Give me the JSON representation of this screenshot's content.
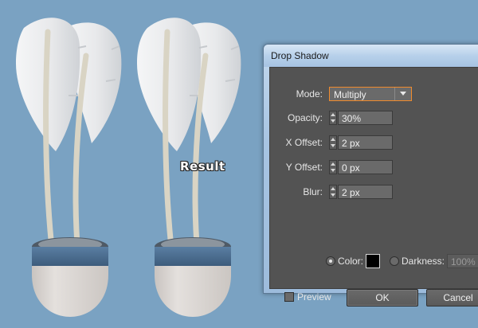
{
  "artwork": {
    "result_label": "Result",
    "colors": {
      "background": "#7aa2c2",
      "feather": "#e6e7e9",
      "pot_band": "#4e6f91",
      "pot_body": "#d8d3cf"
    }
  },
  "dialog": {
    "title": "Drop Shadow",
    "mode": {
      "label": "Mode:",
      "value": "Multiply"
    },
    "opacity": {
      "label": "Opacity:",
      "value": "30%"
    },
    "x_offset": {
      "label": "X Offset:",
      "value": "2 px"
    },
    "y_offset": {
      "label": "Y Offset:",
      "value": "0 px"
    },
    "blur": {
      "label": "Blur:",
      "value": "2 px"
    },
    "color_option": {
      "label": "Color:",
      "selected": true,
      "swatch": "#000000"
    },
    "darkness_option": {
      "label": "Darkness:",
      "value": "100%",
      "selected": false
    },
    "preview": {
      "label": "Preview",
      "checked": false
    },
    "ok_label": "OK",
    "cancel_label": "Cancel"
  }
}
